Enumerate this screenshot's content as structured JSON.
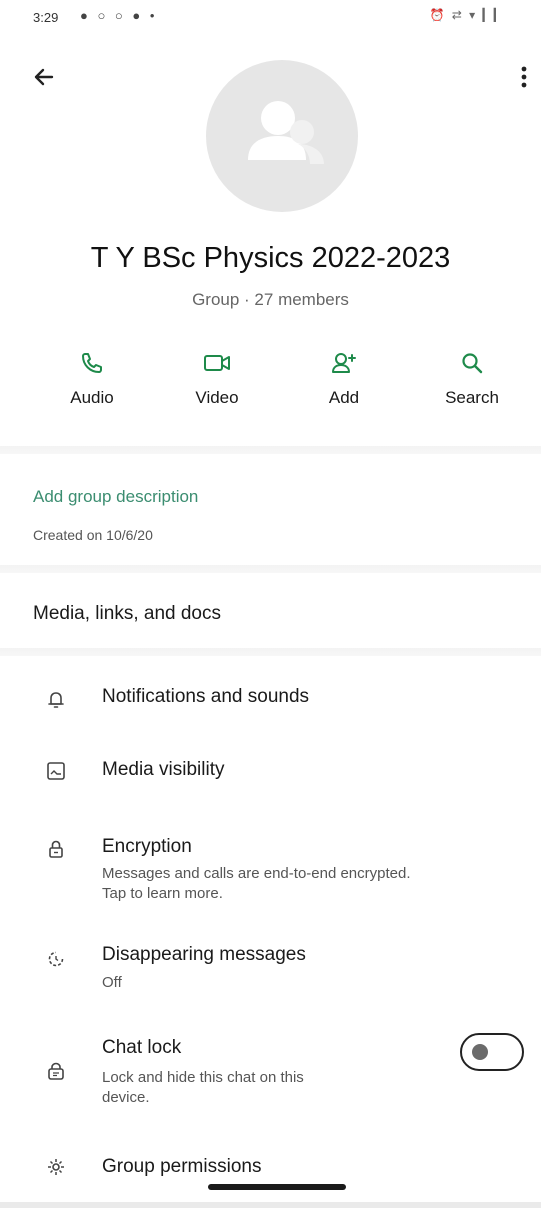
{
  "status_bar": {
    "time": "3:29",
    "left_icons": "● ○ ○ ● •",
    "right_icons": "⏰ ⇄ ▾ ▎▎"
  },
  "group": {
    "name": "T Y BSc Physics 2022-2023",
    "meta": "Group · 27 members"
  },
  "actions": [
    {
      "label": "Audio",
      "icon": "phone-icon"
    },
    {
      "label": "Video",
      "icon": "video-icon"
    },
    {
      "label": "Add",
      "icon": "add-person-icon"
    },
    {
      "label": "Search",
      "icon": "search-icon"
    }
  ],
  "description": {
    "add_label": "Add group description",
    "created": "Created on 10/6/20"
  },
  "media_label": "Media, links, and docs",
  "settings": {
    "notifications": {
      "title": "Notifications and sounds"
    },
    "media_visibility": {
      "title": "Media visibility"
    },
    "encryption": {
      "title": "Encryption",
      "subtitle_line1": "Messages and calls are end-to-end encrypted.",
      "subtitle_line2": "Tap to learn more."
    },
    "disappearing": {
      "title": "Disappearing messages",
      "subtitle": "Off"
    },
    "chat_lock": {
      "title": "Chat lock",
      "subtitle_line1": "Lock and hide this chat on this",
      "subtitle_line2": "device.",
      "enabled": false
    },
    "group_permissions": {
      "title": "Group permissions"
    }
  },
  "colors": {
    "accent_green": "#3b8d70",
    "icon_green": "#1e8a4a"
  }
}
